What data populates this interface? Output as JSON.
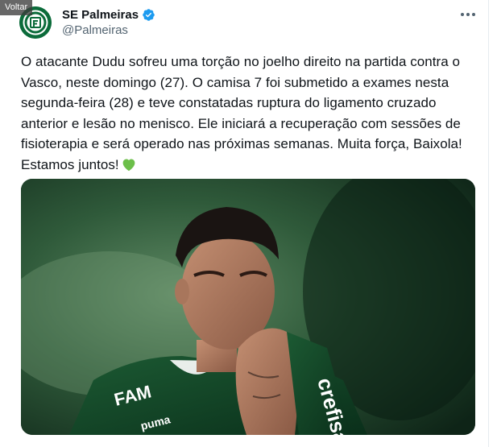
{
  "nav": {
    "back_label": "Voltar"
  },
  "author": {
    "display_name": "SE Palmeiras",
    "handle": "@Palmeiras",
    "verified": true,
    "avatar_icon": "palmeiras-crest-icon"
  },
  "tweet": {
    "text_lines": [
      "O atacante Dudu sofreu uma torção no joelho direito na partida contra o",
      "Vasco, neste domingo (27). O camisa 7 foi submetido a exames nesta",
      "segunda-feira (28) e teve constatadas ruptura do ligamento cruzado",
      "anterior e lesão no menisco. Ele iniciará a recuperação com sessões de",
      "fisioterapia e será operado nas próximas semanas. Muita força, Baixola!",
      "Estamos juntos!"
    ],
    "emoji": "green-heart-icon"
  },
  "media": {
    "jersey_sponsor": "crefisa",
    "jersey_brand": "FAM",
    "kit_brand": "puma"
  },
  "colors": {
    "accent_verified": "#1d9bf0",
    "text_primary": "#0f1419",
    "text_secondary": "#536471",
    "palmeiras_green": "#0b6b3a",
    "heart_green": "#6cbf4a"
  }
}
